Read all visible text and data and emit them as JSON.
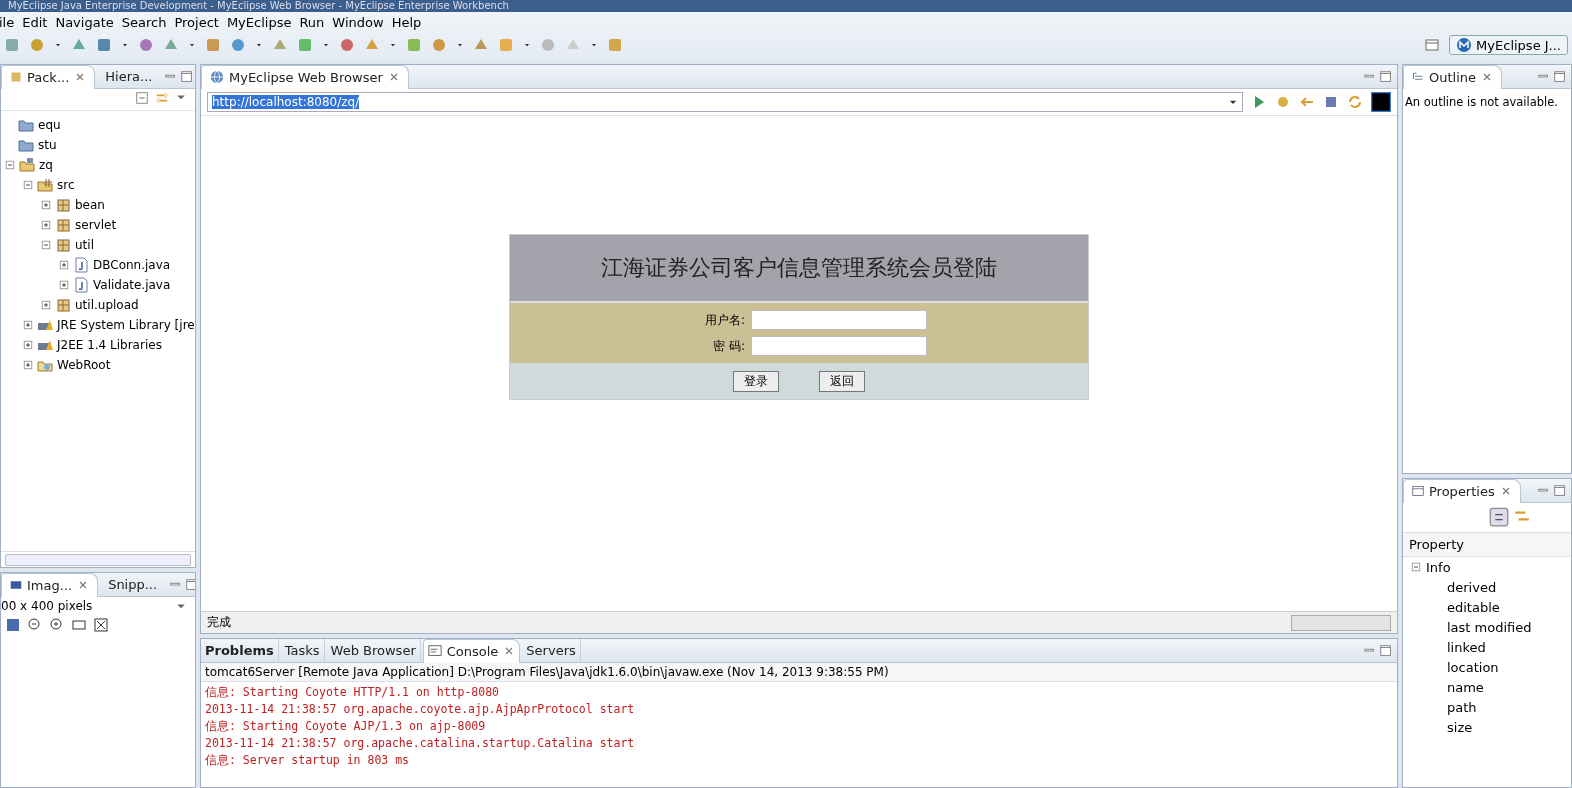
{
  "window": {
    "title": "MyEclipse Java Enterprise Development - MyEclipse Web Browser - MyEclipse Enterprise Workbench"
  },
  "menu": [
    "ile",
    "Edit",
    "Navigate",
    "Search",
    "Project",
    "MyEclipse",
    "Run",
    "Window",
    "Help"
  ],
  "toolbar": {
    "perspective": "MyEclipse J..."
  },
  "package_explorer": {
    "tabs": [
      {
        "label": "Pack...",
        "selected": true
      },
      {
        "label": "Hiera...",
        "selected": false
      }
    ],
    "tree": [
      {
        "label": "equ",
        "kind": "folder"
      },
      {
        "label": "stu",
        "kind": "folder"
      },
      {
        "label": "zq",
        "kind": "project",
        "expanded": true,
        "children": [
          {
            "label": "src",
            "kind": "source",
            "expanded": true,
            "children": [
              {
                "label": "bean",
                "kind": "package",
                "expanded": false
              },
              {
                "label": "servlet",
                "kind": "package",
                "expanded": false
              },
              {
                "label": "util",
                "kind": "package",
                "expanded": true,
                "children": [
                  {
                    "label": "DBConn.java",
                    "kind": "java",
                    "expanded": false
                  },
                  {
                    "label": "Validate.java",
                    "kind": "java",
                    "expanded": false
                  }
                ]
              },
              {
                "label": "util.upload",
                "kind": "package",
                "expanded": false
              }
            ]
          },
          {
            "label": "JRE System Library [jre",
            "kind": "library",
            "expanded": false
          },
          {
            "label": "J2EE 1.4 Libraries",
            "kind": "library",
            "expanded": false
          },
          {
            "label": "WebRoot",
            "kind": "webroot",
            "expanded": false
          }
        ]
      }
    ]
  },
  "image_view": {
    "tabs": [
      {
        "label": "Imag...",
        "selected": true
      },
      {
        "label": "Snipp...",
        "selected": false
      }
    ],
    "info": "00 x 400 pixels"
  },
  "browser": {
    "tab": "MyEclipse Web Browser",
    "url": "http://localhost:8080/zq/",
    "status": "完成",
    "page": {
      "title": "江海证券公司客户信息管理系统会员登陆",
      "fields": [
        {
          "label": "用户名:"
        },
        {
          "label": "密 码:"
        }
      ],
      "buttons": [
        "登录",
        "返回"
      ]
    }
  },
  "bottom_views": {
    "tabs": [
      {
        "label": "Problems",
        "selected": false
      },
      {
        "label": "Tasks",
        "selected": false
      },
      {
        "label": "Web Browser",
        "selected": false
      },
      {
        "label": "Console",
        "selected": true
      },
      {
        "label": "Servers",
        "selected": false
      }
    ],
    "console": {
      "header": "tomcat6Server [Remote Java Application] D:\\Program Files\\Java\\jdk1.6.0\\bin\\javaw.exe (Nov 14, 2013 9:38:55 PM)",
      "lines": [
        "信息: Starting Coyote HTTP/1.1 on http-8080",
        "2013-11-14 21:38:57 org.apache.coyote.ajp.AjpAprProtocol start",
        "信息: Starting Coyote AJP/1.3 on ajp-8009",
        "2013-11-14 21:38:57 org.apache.catalina.startup.Catalina start",
        "信息: Server startup in 803 ms"
      ]
    }
  },
  "outline": {
    "tab": "Outline",
    "message": "An outline is not available."
  },
  "properties": {
    "tab": "Properties",
    "column": "Property",
    "groups": [
      {
        "label": "Info",
        "expanded": true,
        "items": [
          "derived",
          "editable",
          "last modified",
          "linked",
          "location",
          "name",
          "path",
          "size"
        ]
      }
    ]
  }
}
